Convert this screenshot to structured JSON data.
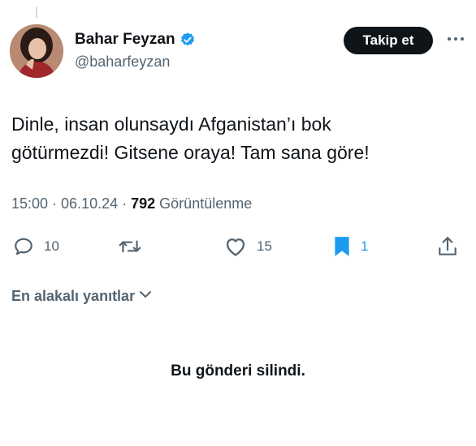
{
  "author": {
    "display_name": "Bahar Feyzan",
    "handle": "@baharfeyzan",
    "verified": true
  },
  "follow_button": {
    "label": "Takip et"
  },
  "tweet": {
    "lines": [
      "Dinle, insan olunsaydı Afganistan’ı bok",
      "götürmezdi! Gitsene oraya! Tam sana göre!"
    ],
    "time": "15:00",
    "date": "06.10.24",
    "separator": "·",
    "views_count": "792",
    "views_label": "Görüntülenme"
  },
  "actions": {
    "reply_count": "10",
    "retweet_count": "",
    "like_count": "15",
    "bookmark_count": "1"
  },
  "replies_sort": {
    "label": "En alakalı yanıtlar"
  },
  "deleted_notice": "Bu gönderi silindi.",
  "colors": {
    "text": "#0f1419",
    "secondary": "#536471",
    "accent": "#1d9bf0",
    "follow_bg": "#0f1419"
  },
  "icons": [
    "verified-badge-icon",
    "more-icon",
    "reply-icon",
    "retweet-icon",
    "like-icon",
    "bookmark-icon",
    "share-icon",
    "chevron-down-icon"
  ]
}
